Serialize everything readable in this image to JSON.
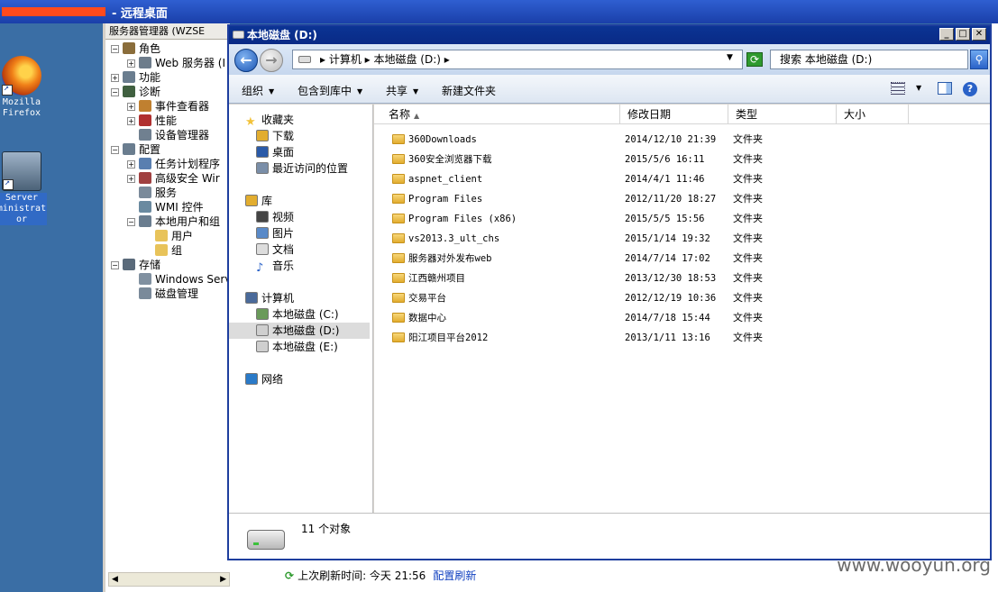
{
  "rdp": {
    "title": "-  远程桌面"
  },
  "desktop": {
    "icons": [
      {
        "label": "Mozilla Firefox"
      },
      {
        "label": "Server ministrat or"
      }
    ]
  },
  "server_manager": {
    "header": "服务器管理器 (WZSE",
    "tree": [
      {
        "label": "角色",
        "exp": "−"
      },
      {
        "label": "Web 服务器 (I",
        "exp": "+"
      },
      {
        "label": "功能",
        "exp": "+"
      },
      {
        "label": "诊断",
        "exp": "−"
      },
      {
        "label": "事件查看器",
        "exp": "+"
      },
      {
        "label": "性能",
        "exp": "+"
      },
      {
        "label": "设备管理器",
        "exp": ""
      },
      {
        "label": "配置",
        "exp": "−"
      },
      {
        "label": "任务计划程序",
        "exp": "+"
      },
      {
        "label": "高级安全 Wir",
        "exp": "+"
      },
      {
        "label": "服务",
        "exp": ""
      },
      {
        "label": "WMI 控件",
        "exp": ""
      },
      {
        "label": "本地用户和组",
        "exp": "−"
      },
      {
        "label": "用户",
        "exp": ""
      },
      {
        "label": "组",
        "exp": ""
      },
      {
        "label": "存储",
        "exp": "−"
      },
      {
        "label": "Windows Serv",
        "exp": ""
      },
      {
        "label": "磁盘管理",
        "exp": ""
      }
    ],
    "status": {
      "label": "上次刷新时间: 今天 21:56",
      "link": "配置刷新"
    }
  },
  "explorer": {
    "title": "本地磁盘  (D:)",
    "breadcrumb": "▸ 计算机 ▸ 本地磁盘  (D:) ▸",
    "search_placeholder": "搜索 本地磁盘  (D:)",
    "toolbar": {
      "organize": "组织",
      "include": "包含到库中",
      "share": "共享",
      "new_folder": "新建文件夹"
    },
    "nav": {
      "favorites": "收藏夹",
      "downloads": "下载",
      "desktop": "桌面",
      "recent": "最近访问的位置",
      "libraries": "库",
      "videos": "视频",
      "pictures": "图片",
      "documents": "文档",
      "music": "音乐",
      "computer": "计算机",
      "drive_c": "本地磁盘  (C:)",
      "drive_d": "本地磁盘  (D:)",
      "drive_e": "本地磁盘  (E:)",
      "network": "网络"
    },
    "columns": {
      "name": "名称",
      "date": "修改日期",
      "type": "类型",
      "size": "大小"
    },
    "files": [
      {
        "name": "360Downloads",
        "date": "2014/12/10 21:39",
        "type": "文件夹"
      },
      {
        "name": "360安全浏览器下载",
        "date": "2015/5/6 16:11",
        "type": "文件夹"
      },
      {
        "name": "aspnet_client",
        "date": "2014/4/1 11:46",
        "type": "文件夹"
      },
      {
        "name": "Program Files",
        "date": "2012/11/20 18:27",
        "type": "文件夹"
      },
      {
        "name": "Program Files (x86)",
        "date": "2015/5/5 15:56",
        "type": "文件夹"
      },
      {
        "name": "vs2013.3_ult_chs",
        "date": "2015/1/14 19:32",
        "type": "文件夹"
      },
      {
        "name": "服务器对外发布web",
        "date": "2014/7/14 17:02",
        "type": "文件夹"
      },
      {
        "name": "江西赣州项目",
        "date": "2013/12/30 18:53",
        "type": "文件夹"
      },
      {
        "name": "交易平台",
        "date": "2012/12/19 10:36",
        "type": "文件夹"
      },
      {
        "name": "数据中心",
        "date": "2014/7/18 15:44",
        "type": "文件夹"
      },
      {
        "name": "阳江项目平台2012",
        "date": "2013/1/11 13:16",
        "type": "文件夹"
      }
    ],
    "count": "11 个对象"
  },
  "watermark": "www.wooyun.org",
  "colors": {
    "accent": "#0a2a86",
    "desktop": "#3a6ea5",
    "folder": "#e2ad2f"
  }
}
